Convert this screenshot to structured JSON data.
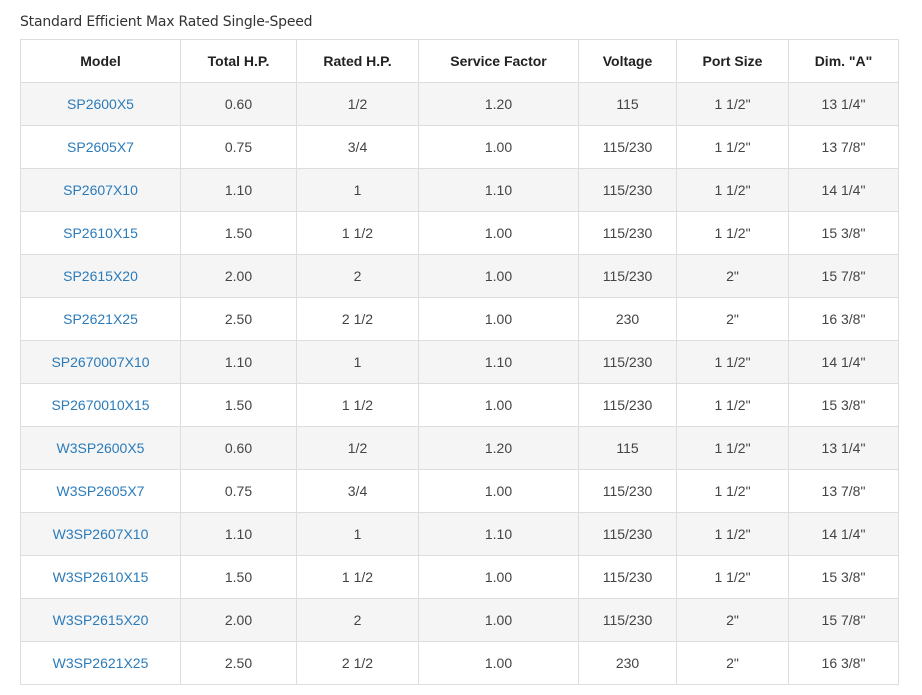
{
  "caption": "Standard Efficient Max Rated Single-Speed",
  "headers": [
    "Model",
    "Total H.P.",
    "Rated H.P.",
    "Service Factor",
    "Voltage",
    "Port Size",
    "Dim. \"A\""
  ],
  "rows": [
    [
      "SP2600X5",
      "0.60",
      "1/2",
      "1.20",
      "115",
      "1 1/2\"",
      "13 1/4\""
    ],
    [
      "SP2605X7",
      "0.75",
      "3/4",
      "1.00",
      "115/230",
      "1 1/2\"",
      "13 7/8\""
    ],
    [
      "SP2607X10",
      "1.10",
      "1",
      "1.10",
      "115/230",
      "1 1/2\"",
      "14 1/4\""
    ],
    [
      "SP2610X15",
      "1.50",
      "1 1/2",
      "1.00",
      "115/230",
      "1 1/2\"",
      "15 3/8\""
    ],
    [
      "SP2615X20",
      "2.00",
      "2",
      "1.00",
      "115/230",
      "2\"",
      "15 7/8\""
    ],
    [
      "SP2621X25",
      "2.50",
      "2 1/2",
      "1.00",
      "230",
      "2\"",
      "16 3/8\""
    ],
    [
      "SP2670007X10",
      "1.10",
      "1",
      "1.10",
      "115/230",
      "1 1/2\"",
      "14 1/4\""
    ],
    [
      "SP2670010X15",
      "1.50",
      "1 1/2",
      "1.00",
      "115/230",
      "1 1/2\"",
      "15 3/8\""
    ],
    [
      "W3SP2600X5",
      "0.60",
      "1/2",
      "1.20",
      "115",
      "1 1/2\"",
      "13 1/4\""
    ],
    [
      "W3SP2605X7",
      "0.75",
      "3/4",
      "1.00",
      "115/230",
      "1 1/2\"",
      "13 7/8\""
    ],
    [
      "W3SP2607X10",
      "1.10",
      "1",
      "1.10",
      "115/230",
      "1 1/2\"",
      "14 1/4\""
    ],
    [
      "W3SP2610X15",
      "1.50",
      "1 1/2",
      "1.00",
      "115/230",
      "1 1/2\"",
      "15 3/8\""
    ],
    [
      "W3SP2615X20",
      "2.00",
      "2",
      "1.00",
      "115/230",
      "2\"",
      "15 7/8\""
    ],
    [
      "W3SP2621X25",
      "2.50",
      "2 1/2",
      "1.00",
      "230",
      "2\"",
      "16 3/8\""
    ]
  ],
  "colors": {
    "link": "#2b7bba",
    "stripe": "#f5f5f5",
    "border": "#dddddd"
  }
}
